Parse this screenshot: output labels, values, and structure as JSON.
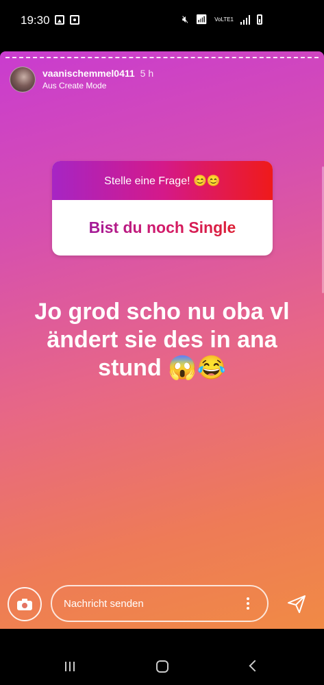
{
  "status_bar": {
    "time": "19:30",
    "left_icons": [
      "image-icon",
      "screen-record-icon"
    ],
    "right_icons": [
      "mute-icon",
      "wifi-icon",
      "volte-icon",
      "signal-icon",
      "battery-icon"
    ],
    "volte_label": "VoLTE1"
  },
  "story": {
    "username": "vaanischemmel0411",
    "time_ago": "5 h",
    "subtitle": "Aus Create Mode",
    "question_sticker": {
      "prompt": "Stelle eine Frage! 😊😊",
      "question": "Bist du noch Single"
    },
    "answer_text": "Jo grod scho nu oba vl ändert sie des in ana stund 😱😂",
    "gradient_colors": [
      "#c93ccf",
      "#e76786",
      "#f08a45"
    ]
  },
  "reply_bar": {
    "camera_icon": "camera-icon",
    "placeholder": "Nachricht senden",
    "more_icon": "more-vertical-icon",
    "send_icon": "send-icon"
  },
  "nav_bar": {
    "buttons": [
      "recent-apps-icon",
      "home-icon",
      "back-icon"
    ]
  }
}
